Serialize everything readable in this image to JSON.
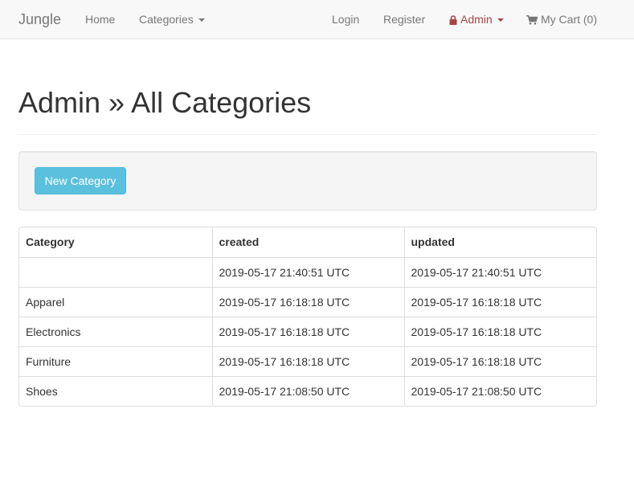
{
  "navbar": {
    "brand": "Jungle",
    "home": "Home",
    "categories": "Categories",
    "login": "Login",
    "register": "Register",
    "admin": "Admin",
    "cart": "My Cart (0)",
    "admin_color": "#a94442"
  },
  "page": {
    "title": "Admin » All Categories"
  },
  "actions": {
    "new_category": "New Category",
    "button_color": "#5bc0de"
  },
  "table": {
    "headers": [
      "Category",
      "created",
      "updated"
    ],
    "rows": [
      [
        "",
        "2019-05-17 21:40:51 UTC",
        "2019-05-17 21:40:51 UTC"
      ],
      [
        "Apparel",
        "2019-05-17 16:18:18 UTC",
        "2019-05-17 16:18:18 UTC"
      ],
      [
        "Electronics",
        "2019-05-17 16:18:18 UTC",
        "2019-05-17 16:18:18 UTC"
      ],
      [
        "Furniture",
        "2019-05-17 16:18:18 UTC",
        "2019-05-17 16:18:18 UTC"
      ],
      [
        "Shoes",
        "2019-05-17 21:08:50 UTC",
        "2019-05-17 21:08:50 UTC"
      ]
    ]
  }
}
